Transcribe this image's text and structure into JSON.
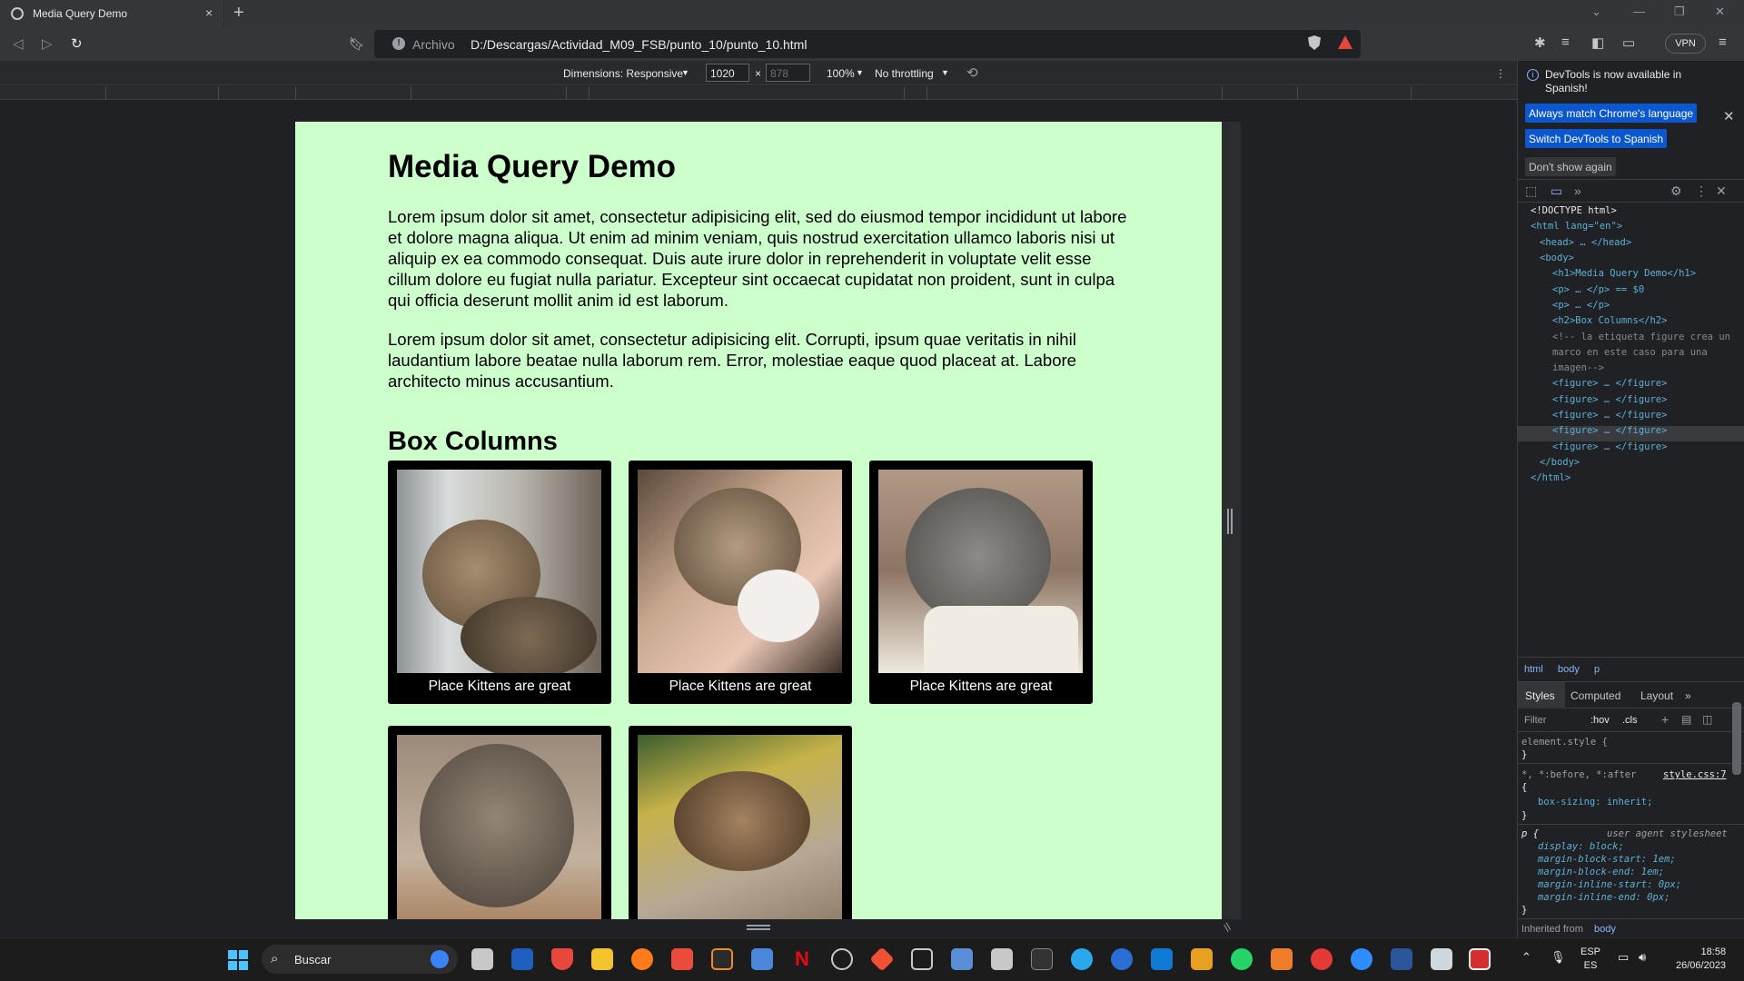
{
  "browser": {
    "tab_title": "Media Query Demo",
    "tab_close": "×",
    "new_tab": "+",
    "address_scheme": "Archivo",
    "address_url": "D:/Descargas/Actividad_M09_FSB/punto_10/punto_10.html",
    "vpn_label": "VPN"
  },
  "device_toolbar": {
    "dimensions_label": "Dimensions: Responsive",
    "width_value": "1020",
    "height_placeholder": "878",
    "times": "×",
    "zoom": "100%",
    "throttling": "No throttling"
  },
  "page": {
    "heading": "Media Query Demo",
    "paragraph_1": "Lorem ipsum dolor sit amet, consectetur adipisicing elit, sed do eiusmod tempor incididunt ut labore et dolore magna aliqua. Ut enim ad minim veniam, quis nostrud exercitation ullamco laboris nisi ut aliquip ex ea commodo consequat. Duis aute irure dolor in reprehenderit in voluptate velit esse cillum dolore eu fugiat nulla pariatur. Excepteur sint occaecat cupidatat non proident, sunt in culpa qui officia deserunt mollit anim id est laborum.",
    "paragraph_2": "Lorem ipsum dolor sit amet, consectetur adipisicing elit. Corrupti, ipsum quae veritatis in nihil laudantium labore beatae nulla laborum rem. Error, molestiae eaque quod placeat at. Labore architecto minus accusantium.",
    "subheading": "Box Columns",
    "figures": [
      {
        "caption": "Place Kittens are great"
      },
      {
        "caption": "Place Kittens are great"
      },
      {
        "caption": "Place Kittens are great"
      },
      {
        "caption": ""
      },
      {
        "caption": ""
      }
    ],
    "background_color": "#ccffcc"
  },
  "devtools": {
    "notice_text": "DevTools is now available in Spanish!",
    "btn_match_language": "Always match Chrome's language",
    "btn_switch_spanish": "Switch DevTools to Spanish",
    "btn_dont_show": "Don't show again",
    "dom": {
      "doctype": "<!DOCTYPE html>",
      "html_open": "<html lang=\"en\">",
      "head": "<head> … </head>",
      "body_open": "<body>",
      "h1": "<h1>Media Query Demo</h1>",
      "p_selected": "<p> … </p> == $0",
      "p2": "<p> … </p>",
      "h2": "<h2>Box Columns</h2>",
      "comment_1": "<!-- la etiqueta figure crea un",
      "comment_2": "marco en este caso para una",
      "comment_3": "imagen-->",
      "figures": [
        "<figure> … </figure>",
        "<figure> … </figure>",
        "<figure> … </figure>",
        "<figure> … </figure>",
        "<figure> … </figure>"
      ],
      "body_close": "</body>",
      "html_close": "</html>"
    },
    "breadcrumbs": [
      "html",
      "body",
      "p"
    ],
    "style_tabs": [
      "Styles",
      "Computed",
      "Layout"
    ],
    "filter_placeholder": "Filter",
    "filter_hov": ":hov",
    "filter_cls": ".cls",
    "styles": {
      "element_style": "element.style {",
      "close_brace": "}",
      "universal_selector": "*, *:before, *:after",
      "universal_source": "style.css:7",
      "open_brace": "{",
      "box_sizing": "box-sizing: inherit;",
      "p_selector": "p {",
      "ua_label": "user agent stylesheet",
      "display": "display: block;",
      "margin_block_start": "margin-block-start: 1em;",
      "margin_block_end": "margin-block-end: 1em;",
      "margin_inline_start": "margin-inline-start: 0px;",
      "margin_inline_end": "margin-inline-end: 0px;",
      "inherited_label": "Inherited from",
      "inherited_source": "body"
    }
  },
  "taskbar": {
    "search_label": "Buscar",
    "lang_1": "ESP",
    "lang_2": "ES",
    "time": "18:58",
    "date": "26/06/2023"
  }
}
